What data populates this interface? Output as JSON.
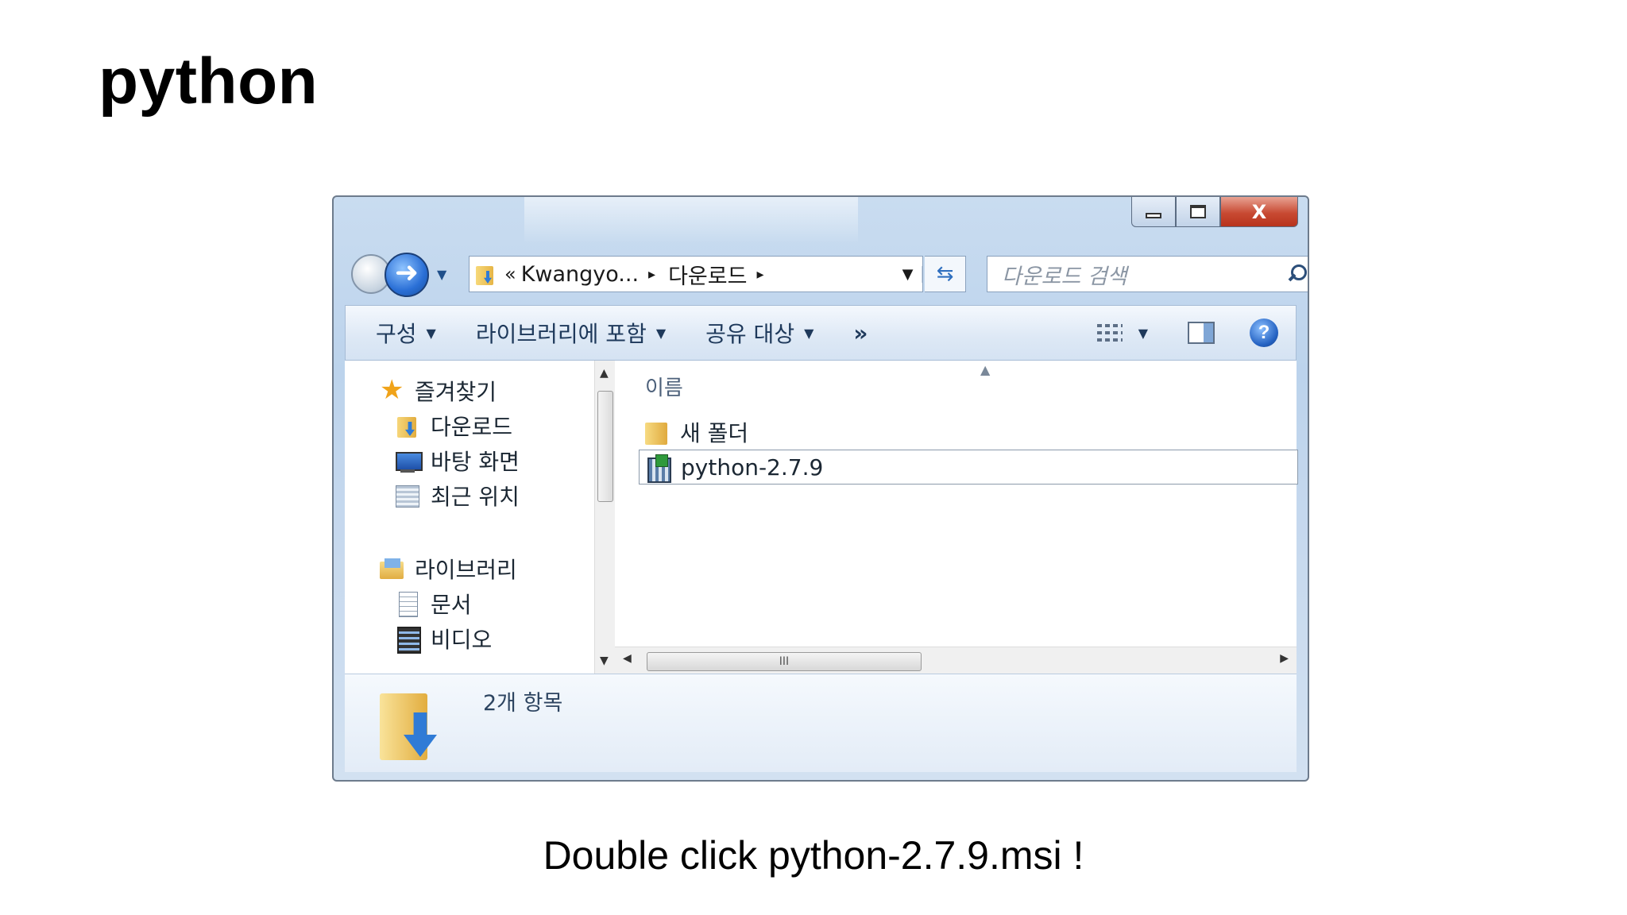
{
  "slide": {
    "title": "python",
    "caption": "Double click python-2.7.9.msi !"
  },
  "window": {
    "close_glyph": "X",
    "address": {
      "overflow": "«",
      "segments": [
        "Kwangyo...",
        "다운로드"
      ],
      "separator": "▸"
    },
    "search_placeholder": "다운로드 검색",
    "command_bar": {
      "items": [
        "구성",
        "라이브러리에 포함",
        "공유 대상"
      ],
      "more": "»",
      "help": "?"
    },
    "nav_pane": {
      "favorites": "즐겨찾기",
      "favorite_items": [
        "다운로드",
        "바탕 화면",
        "최근 위치"
      ],
      "libraries": "라이브러리",
      "library_items": [
        "문서",
        "비디오"
      ]
    },
    "content": {
      "column_header": "이름",
      "files": [
        {
          "name": "새 폴더",
          "icon": "folder-icon"
        },
        {
          "name": "python-2.7.9",
          "icon": "installer-icon"
        }
      ]
    },
    "details": {
      "item_count": "2개 항목"
    },
    "colors": {
      "frame": "#c9dcf0",
      "close_button": "#c84a33",
      "selection_border": "#8b9aab"
    }
  }
}
